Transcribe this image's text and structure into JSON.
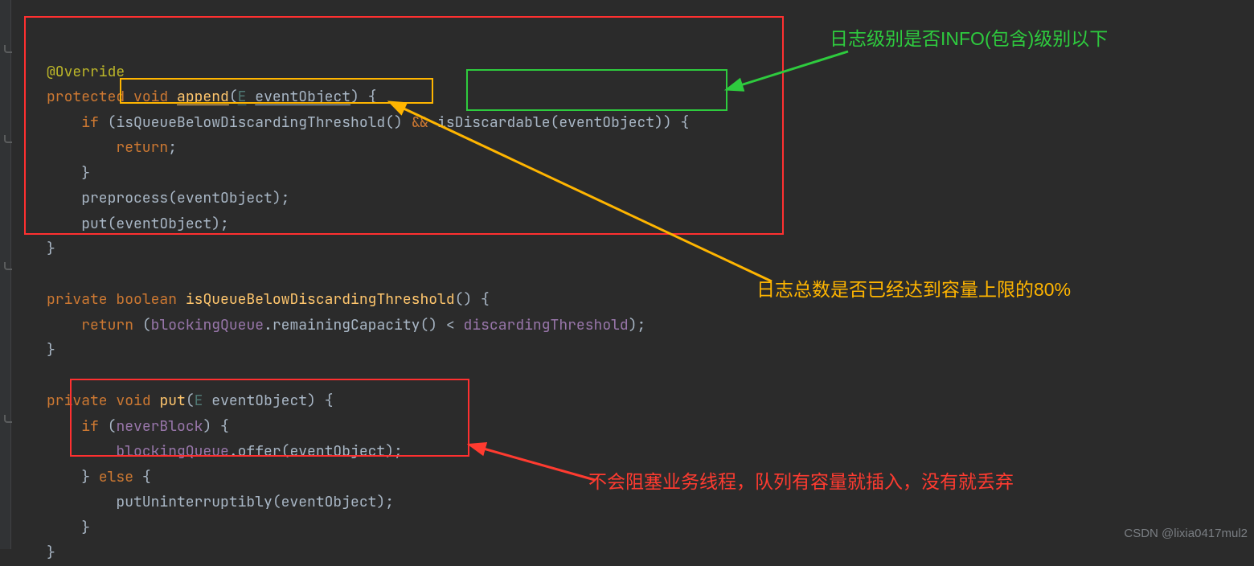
{
  "code": {
    "l1": "@Override",
    "l2_protected": "protected",
    "l2_void": "void",
    "l2_method": "append",
    "l2_type": "E",
    "l2_param": "eventObject",
    "l3_if": "if",
    "l3_m1": "isQueueBelowDiscardingThreshold",
    "l3_and": "&&",
    "l3_m2": "isDiscardable",
    "l3_arg": "eventObject",
    "l4_return": "return",
    "l6_call": "preprocess",
    "l6_arg": "eventObject",
    "l7_call": "put",
    "l7_arg": "eventObject",
    "l9_private": "private",
    "l9_bool": "boolean",
    "l9_method": "isQueueBelowDiscardingThreshold",
    "l10_return": "return",
    "l10_f1": "blockingQueue",
    "l10_call": "remainingCapacity",
    "l10_lt": "<",
    "l10_f2": "discardingThreshold",
    "l12_private": "private",
    "l12_void": "void",
    "l12_method": "put",
    "l12_type": "E",
    "l12_param": "eventObject",
    "l13_if": "if",
    "l13_var": "neverBlock",
    "l14_f": "blockingQueue",
    "l14_call": "offer",
    "l14_arg": "eventObject",
    "l15_else": "else",
    "l16_call": "putUninterruptibly",
    "l16_arg": "eventObject"
  },
  "annotations": {
    "green": "日志级别是否INFO(包含)级别以下",
    "orange": "日志总数是否已经达到容量上限的80%",
    "red": "不会阻塞业务线程，队列有容量就插入，没有就丢弃"
  },
  "watermark": "CSDN @lixia0417mul2"
}
